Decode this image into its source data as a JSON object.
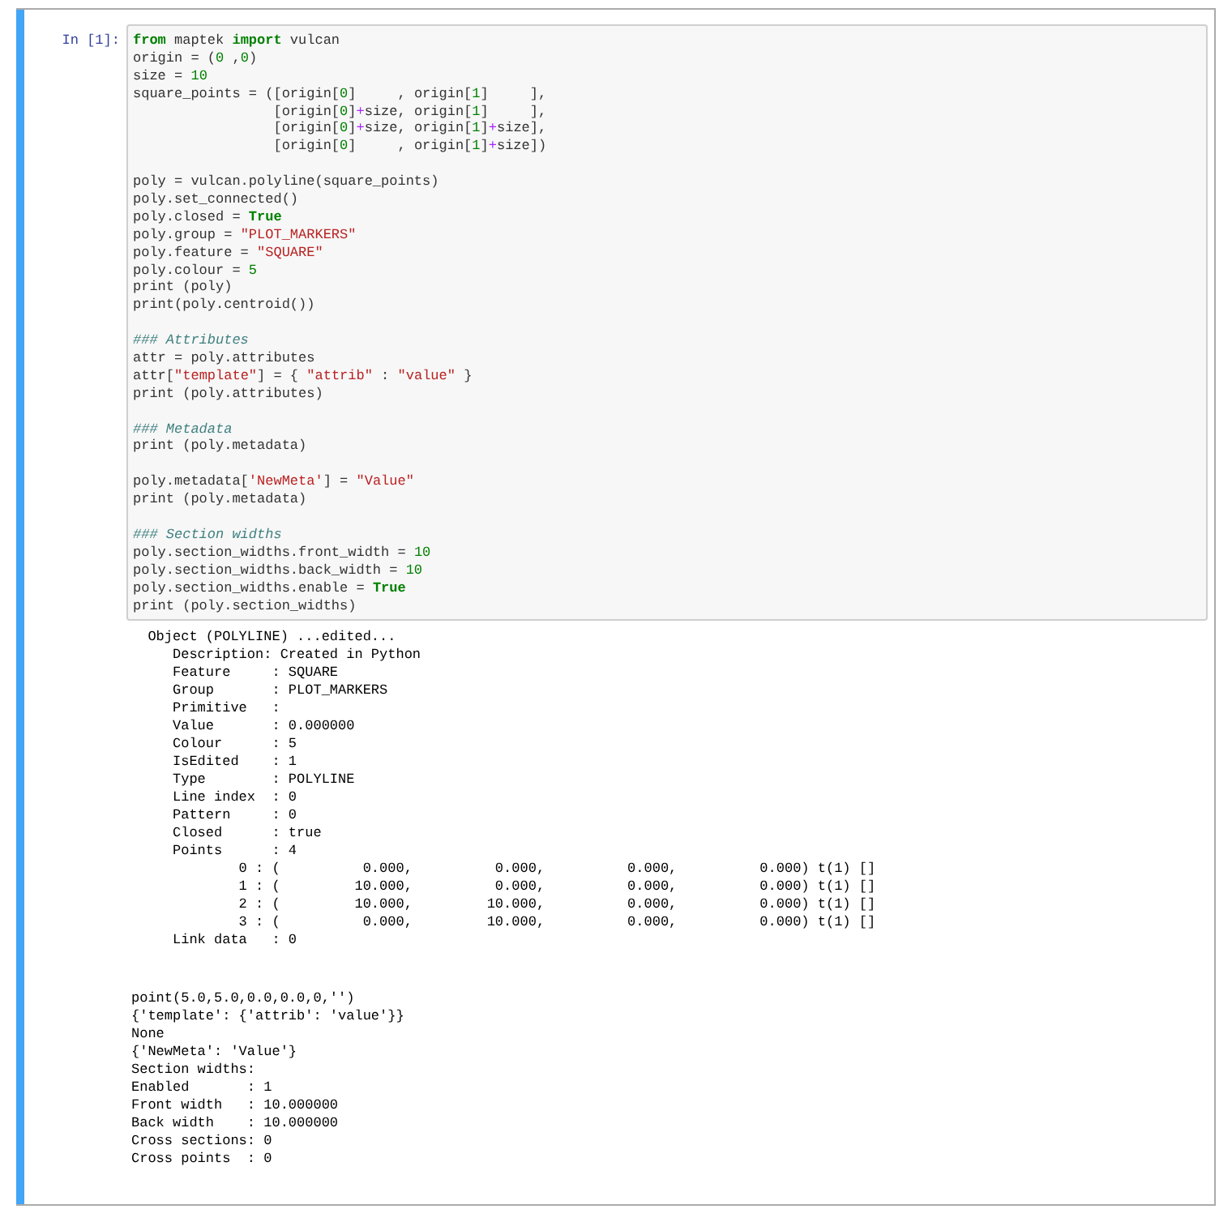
{
  "cell": {
    "prompt": "In [1]:",
    "selected": true,
    "input_blocks": [
      [
        [
          {
            "kind": "kw",
            "text": "from"
          },
          {
            "kind": "plain",
            "text": " maptek "
          },
          {
            "kind": "kw",
            "text": "import"
          },
          {
            "kind": "plain",
            "text": " vulcan"
          }
        ],
        [
          {
            "kind": "plain",
            "text": "origin = ("
          },
          {
            "kind": "num",
            "text": "0"
          },
          {
            "kind": "plain",
            "text": " ,"
          },
          {
            "kind": "num",
            "text": "0"
          },
          {
            "kind": "plain",
            "text": ")"
          }
        ],
        [
          {
            "kind": "plain",
            "text": "size = "
          },
          {
            "kind": "num",
            "text": "10"
          }
        ],
        [
          {
            "kind": "plain",
            "text": "square_points = ([origin["
          },
          {
            "kind": "num",
            "text": "0"
          },
          {
            "kind": "plain",
            "text": "]     , origin["
          },
          {
            "kind": "num",
            "text": "1"
          },
          {
            "kind": "plain",
            "text": "]     ],"
          }
        ],
        [
          {
            "kind": "plain",
            "text": "                 [origin["
          },
          {
            "kind": "num",
            "text": "0"
          },
          {
            "kind": "plain",
            "text": "]"
          },
          {
            "kind": "op",
            "text": "+"
          },
          {
            "kind": "plain",
            "text": "size, origin["
          },
          {
            "kind": "num",
            "text": "1"
          },
          {
            "kind": "plain",
            "text": "]     ],"
          }
        ],
        [
          {
            "kind": "plain",
            "text": "                 [origin["
          },
          {
            "kind": "num",
            "text": "0"
          },
          {
            "kind": "plain",
            "text": "]"
          },
          {
            "kind": "op",
            "text": "+"
          },
          {
            "kind": "plain",
            "text": "size, origin["
          },
          {
            "kind": "num",
            "text": "1"
          },
          {
            "kind": "plain",
            "text": "]"
          },
          {
            "kind": "op",
            "text": "+"
          },
          {
            "kind": "plain",
            "text": "size],"
          }
        ],
        [
          {
            "kind": "plain",
            "text": "                 [origin["
          },
          {
            "kind": "num",
            "text": "0"
          },
          {
            "kind": "plain",
            "text": "]     , origin["
          },
          {
            "kind": "num",
            "text": "1"
          },
          {
            "kind": "plain",
            "text": "]"
          },
          {
            "kind": "op",
            "text": "+"
          },
          {
            "kind": "plain",
            "text": "size])"
          }
        ]
      ],
      [
        [
          {
            "kind": "plain",
            "text": "poly = vulcan.polyline(square_points)"
          }
        ],
        [
          {
            "kind": "plain",
            "text": "poly.set_connected()"
          }
        ],
        [
          {
            "kind": "plain",
            "text": "poly.closed = "
          },
          {
            "kind": "kw",
            "text": "True"
          }
        ],
        [
          {
            "kind": "plain",
            "text": "poly.group = "
          },
          {
            "kind": "str",
            "text": "\"PLOT_MARKERS\""
          }
        ],
        [
          {
            "kind": "plain",
            "text": "poly.feature = "
          },
          {
            "kind": "str",
            "text": "\"SQUARE\""
          }
        ],
        [
          {
            "kind": "plain",
            "text": "poly.colour = "
          },
          {
            "kind": "num",
            "text": "5"
          }
        ],
        [
          {
            "kind": "plain",
            "text": "print (poly)"
          }
        ],
        [
          {
            "kind": "plain",
            "text": "print(poly.centroid())"
          }
        ]
      ],
      [
        [
          {
            "kind": "comment",
            "text": "### Attributes"
          }
        ],
        [
          {
            "kind": "plain",
            "text": "attr = poly.attributes"
          }
        ],
        [
          {
            "kind": "plain",
            "text": "attr["
          },
          {
            "kind": "str",
            "text": "\"template\""
          },
          {
            "kind": "plain",
            "text": "] = { "
          },
          {
            "kind": "str",
            "text": "\"attrib\""
          },
          {
            "kind": "plain",
            "text": " : "
          },
          {
            "kind": "str",
            "text": "\"value\""
          },
          {
            "kind": "plain",
            "text": " }"
          }
        ],
        [
          {
            "kind": "plain",
            "text": "print (poly.attributes)"
          }
        ]
      ],
      [
        [
          {
            "kind": "comment",
            "text": "### Metadata"
          }
        ],
        [
          {
            "kind": "plain",
            "text": "print (poly.metadata)"
          }
        ]
      ],
      [
        [
          {
            "kind": "plain",
            "text": "poly.metadata["
          },
          {
            "kind": "str",
            "text": "'NewMeta'"
          },
          {
            "kind": "plain",
            "text": "] = "
          },
          {
            "kind": "str",
            "text": "\"Value\""
          }
        ],
        [
          {
            "kind": "plain",
            "text": "print (poly.metadata)"
          }
        ]
      ],
      [
        [
          {
            "kind": "comment",
            "text": "### Section widths"
          }
        ],
        [
          {
            "kind": "plain",
            "text": "poly.section_widths.front_width = "
          },
          {
            "kind": "num",
            "text": "10"
          }
        ],
        [
          {
            "kind": "plain",
            "text": "poly.section_widths.back_width = "
          },
          {
            "kind": "num",
            "text": "10"
          }
        ],
        [
          {
            "kind": "plain",
            "text": "poly.section_widths.enable = "
          },
          {
            "kind": "kw",
            "text": "True"
          }
        ],
        [
          {
            "kind": "plain",
            "text": "print (poly.section_widths)"
          }
        ]
      ]
    ],
    "outputs": [
      [
        "  Object (POLYLINE) ...edited...",
        "     Description: Created in Python",
        "     Feature     : SQUARE",
        "     Group       : PLOT_MARKERS",
        "     Primitive   :",
        "     Value       : 0.000000",
        "     Colour      : 5",
        "     IsEdited    : 1",
        "     Type        : POLYLINE",
        "     Line index  : 0",
        "     Pattern     : 0",
        "     Closed      : true",
        "     Points      : 4",
        "             0 : (          0.000,          0.000,          0.000,          0.000) t(1) []",
        "             1 : (         10.000,          0.000,          0.000,          0.000) t(1) []",
        "             2 : (         10.000,         10.000,          0.000,          0.000) t(1) []",
        "             3 : (          0.000,         10.000,          0.000,          0.000) t(1) []",
        "     Link data   : 0"
      ],
      [
        "point(5.0,5.0,0.0,0.0,0,'')",
        "{'template': {'attrib': 'value'}}",
        "None",
        "{'NewMeta': 'Value'}",
        "Section widths:",
        "Enabled       : 1",
        "Front width   : 10.000000",
        "Back width    : 10.000000",
        "Cross sections: 0",
        "Cross points  : 0"
      ]
    ]
  }
}
